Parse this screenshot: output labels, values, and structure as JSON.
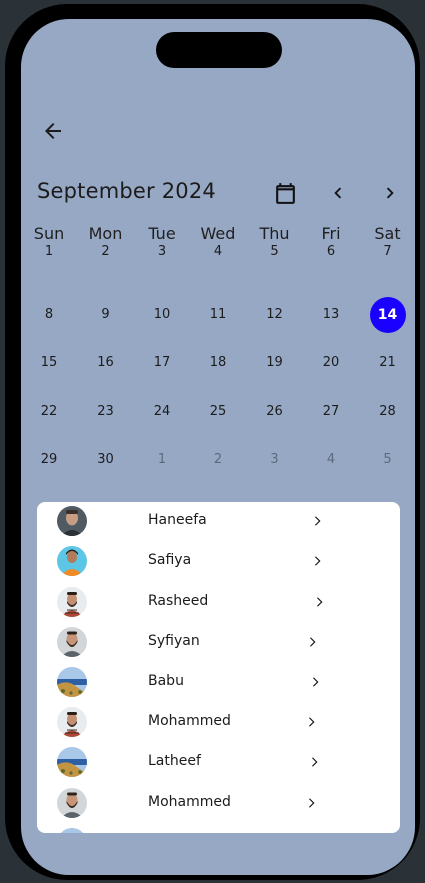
{
  "header": {
    "month_title": "September 2024"
  },
  "calendar": {
    "weekdays": [
      "Sun",
      "Mon",
      "Tue",
      "Wed",
      "Thu",
      "Fri",
      "Sat"
    ],
    "weeks": [
      [
        {
          "d": "1",
          "o": false
        },
        {
          "d": "2",
          "o": false
        },
        {
          "d": "3",
          "o": false
        },
        {
          "d": "4",
          "o": false
        },
        {
          "d": "5",
          "o": false
        },
        {
          "d": "6",
          "o": false
        },
        {
          "d": "7",
          "o": false
        }
      ],
      [
        {
          "d": "8",
          "o": false
        },
        {
          "d": "9",
          "o": false
        },
        {
          "d": "10",
          "o": false
        },
        {
          "d": "11",
          "o": false
        },
        {
          "d": "12",
          "o": false
        },
        {
          "d": "13",
          "o": false
        },
        {
          "d": "14",
          "o": false,
          "sel": true
        }
      ],
      [
        {
          "d": "15",
          "o": false
        },
        {
          "d": "16",
          "o": false
        },
        {
          "d": "17",
          "o": false
        },
        {
          "d": "18",
          "o": false
        },
        {
          "d": "19",
          "o": false
        },
        {
          "d": "20",
          "o": false
        },
        {
          "d": "21",
          "o": false
        }
      ],
      [
        {
          "d": "22",
          "o": false
        },
        {
          "d": "23",
          "o": false
        },
        {
          "d": "24",
          "o": false
        },
        {
          "d": "25",
          "o": false
        },
        {
          "d": "26",
          "o": false
        },
        {
          "d": "27",
          "o": false
        },
        {
          "d": "28",
          "o": false
        }
      ],
      [
        {
          "d": "29",
          "o": false
        },
        {
          "d": "30",
          "o": false
        },
        {
          "d": "1",
          "o": true
        },
        {
          "d": "2",
          "o": true
        },
        {
          "d": "3",
          "o": true
        },
        {
          "d": "4",
          "o": true
        },
        {
          "d": "5",
          "o": true
        }
      ]
    ],
    "selected_color": "#1a00ff"
  },
  "contacts": [
    {
      "name": "Haneefa",
      "avatar": "man-portrait-gray"
    },
    {
      "name": "Safiya",
      "avatar": "woman-orange-shirt"
    },
    {
      "name": "Rasheed",
      "avatar": "man-plaid-shirt"
    },
    {
      "name": "Syfiyan",
      "avatar": "man-beard-gray"
    },
    {
      "name": "Babu",
      "avatar": "landscape-coast"
    },
    {
      "name": "Mohammed",
      "avatar": "man-plaid-shirt"
    },
    {
      "name": "Latheef",
      "avatar": "landscape-coast"
    },
    {
      "name": "Mohammed",
      "avatar": "man-beard-gray"
    }
  ]
}
